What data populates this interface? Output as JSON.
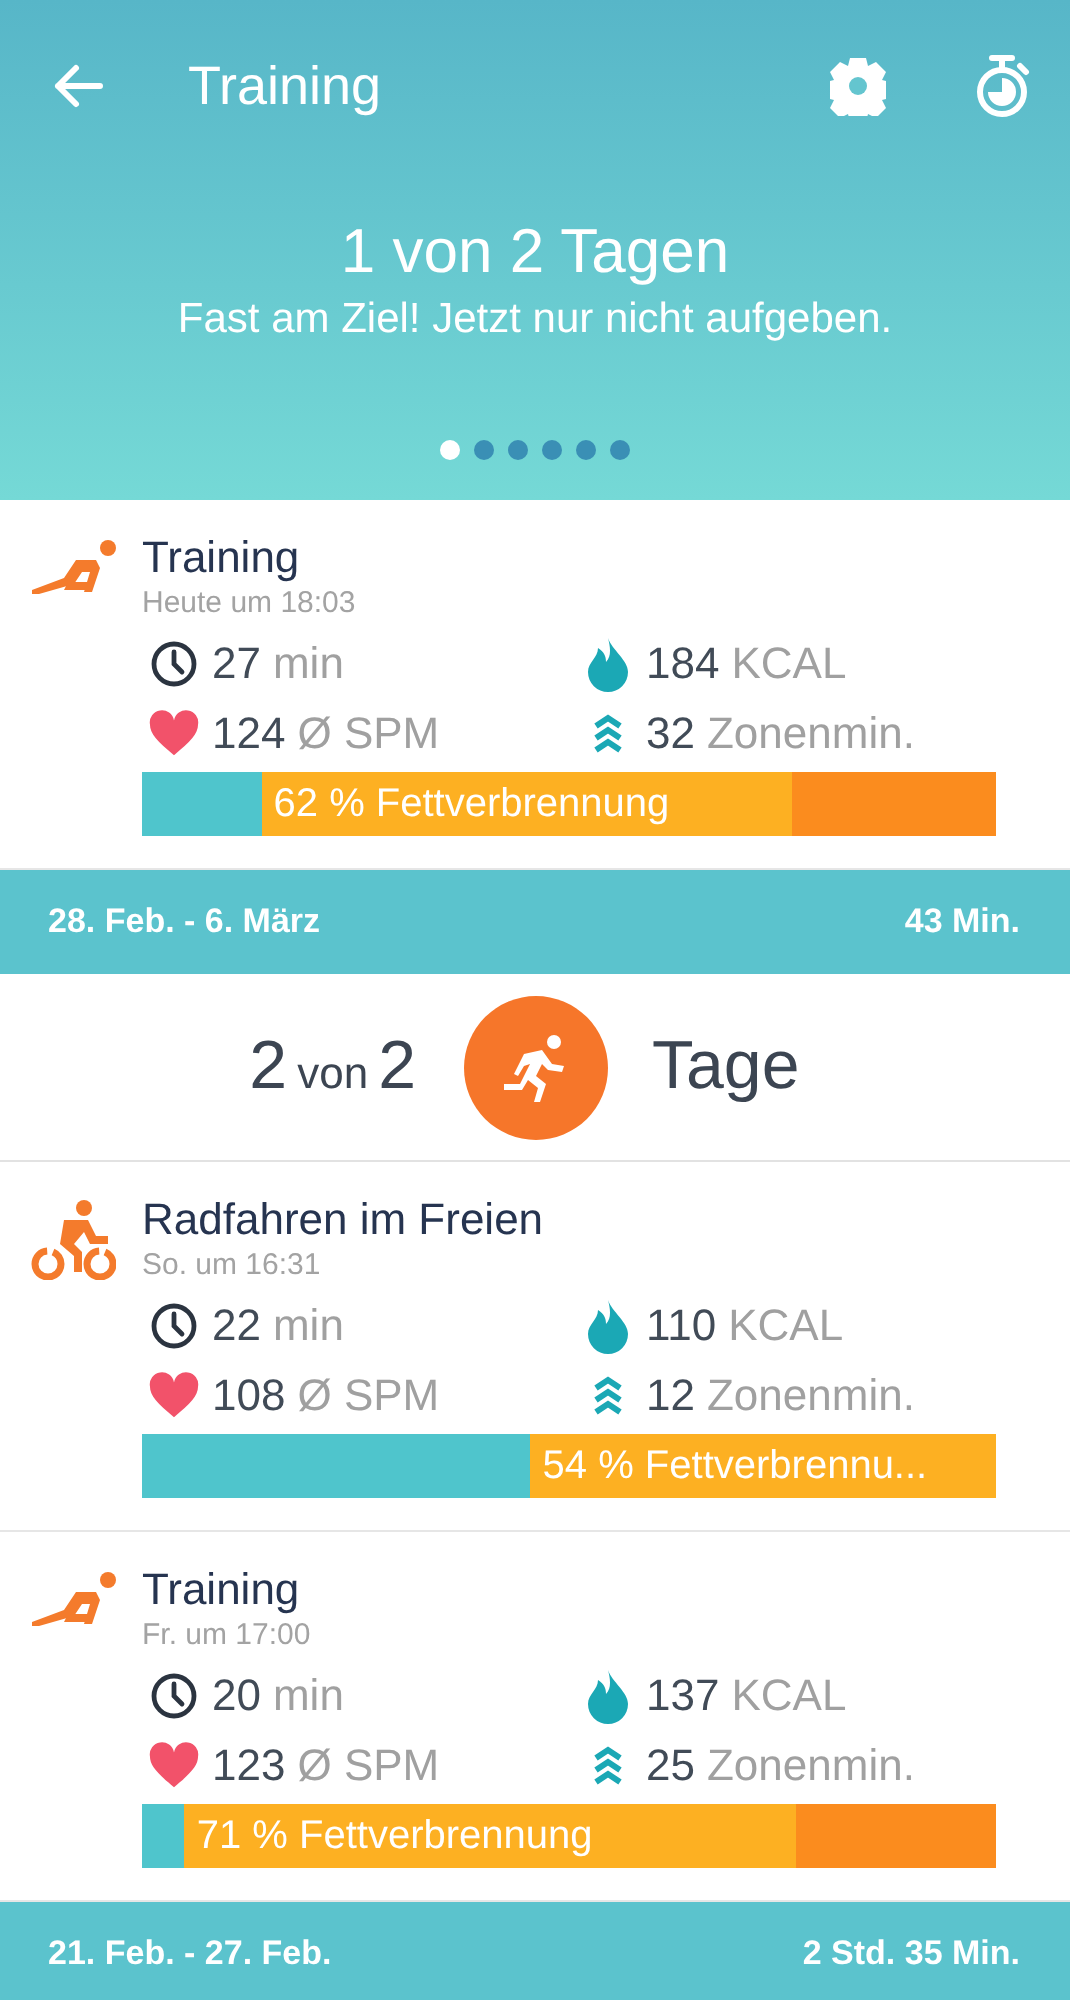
{
  "header": {
    "title": "Training",
    "headline": "1 von 2 Tagen",
    "message": "Fast am Ziel! Jetzt nur nicht aufgeben.",
    "page_dots": [
      {
        "selected": true
      },
      {
        "selected": false
      },
      {
        "selected": false
      },
      {
        "selected": false
      },
      {
        "selected": false
      },
      {
        "selected": false
      }
    ]
  },
  "sections": [
    {
      "kind": "workout",
      "title": "Training",
      "time": "Heute um 18:03",
      "duration": "27",
      "duration_unit": "min",
      "calories": "184",
      "calories_unit": "KCAL",
      "heart_rate": "124",
      "heart_rate_unit": "Ø SPM",
      "zone_minutes": "32",
      "zone_unit": "Zonenmin.",
      "bar": {
        "color": "#fb8c1e",
        "label": "62 % Fettverbrennung",
        "fills": [
          {
            "color": "#4fc5cc",
            "level": 0.14
          },
          {
            "color": "#fdb022",
            "level": 0.76
          }
        ]
      }
    },
    {
      "kind": "week",
      "range": "28. Feb. - 6. März",
      "total": "43 Min."
    },
    {
      "kind": "goal",
      "count": "2",
      "of": "von",
      "target": "2",
      "unit": "Tage"
    },
    {
      "kind": "cycling",
      "title": "Radfahren im Freien",
      "time": "So. um 16:31",
      "duration": "22",
      "duration_unit": "min",
      "calories": "110",
      "calories_unit": "KCAL",
      "heart_rate": "108",
      "heart_rate_unit": "Ø SPM",
      "zone_minutes": "12",
      "zone_unit": "Zonenmin.",
      "bar": {
        "color": "#fdb022",
        "label": "54 % Fettverbrennu...",
        "fills": [
          {
            "color": "#4fc5cc",
            "level": 0.455
          }
        ]
      }
    },
    {
      "kind": "workout",
      "title": "Training",
      "time": "Fr. um 17:00",
      "duration": "20",
      "duration_unit": "min",
      "calories": "137",
      "calories_unit": "KCAL",
      "heart_rate": "123",
      "heart_rate_unit": "Ø SPM",
      "zone_minutes": "25",
      "zone_unit": "Zonenmin.",
      "bar": {
        "color": "#fb8c1e",
        "label": "71 % Fettverbrennung",
        "fills": [
          {
            "color": "#4fc5cc",
            "level": 0.05
          },
          {
            "color": "#fdb022",
            "level": 0.765
          }
        ]
      }
    },
    {
      "kind": "week",
      "range": "21. Feb. - 27. Feb.",
      "total": "2 Std. 35 Min."
    }
  ]
}
